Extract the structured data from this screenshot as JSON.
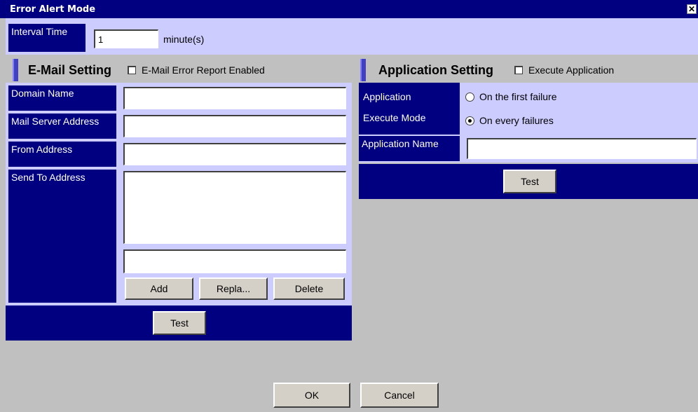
{
  "window": {
    "title": "Error Alert Mode",
    "close_glyph": "✕"
  },
  "interval": {
    "label": "Interval Time",
    "value": "1",
    "unit": "minute(s)"
  },
  "email": {
    "heading": "E-Mail Setting",
    "enable_label": "E-Mail Error Report Enabled",
    "enabled": false,
    "domain_label": "Domain Name",
    "domain_value": "",
    "server_label": "Mail Server Address",
    "server_value": "",
    "from_label": "From Address",
    "from_value": "",
    "sendto_label": "Send To Address",
    "sendto_list": [],
    "sendto_entry": "",
    "add_label": "Add",
    "replace_label": "Repla...",
    "delete_label": "Delete",
    "test_label": "Test"
  },
  "application": {
    "heading": "Application Setting",
    "execute_label": "Execute Application",
    "execute_enabled": false,
    "mode_label_line1": "Application",
    "mode_label_line2": "Execute Mode",
    "option_first": "On the first failure",
    "option_every": "On every failures",
    "selected_option": "every",
    "name_label": "Application Name",
    "name_value": "",
    "test_label": "Test"
  },
  "footer": {
    "ok_label": "OK",
    "cancel_label": "Cancel"
  },
  "colors": {
    "title_bar": "#000080",
    "label_bg": "#000080",
    "panel_bg": "#ccccff",
    "dialog_bg": "#c0c0c0",
    "accent": "#4040c0"
  },
  "icons": {
    "close": "close-icon",
    "radio_on": "radio-selected",
    "radio_off": "radio-unselected"
  }
}
